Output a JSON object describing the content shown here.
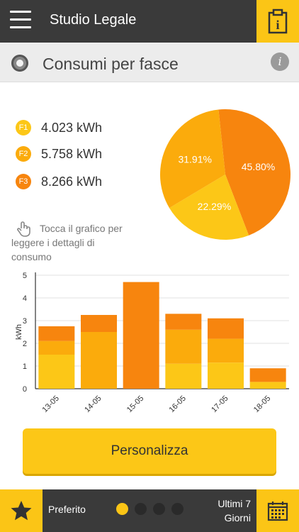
{
  "header": {
    "title": "Studio Legale",
    "menu_icon": "hamburger-icon",
    "info_icon": "clipboard-info-icon",
    "info_glyph": "i"
  },
  "section": {
    "title": "Consumi per fasce",
    "info_glyph": "i"
  },
  "legend": [
    {
      "badge": "F1",
      "value": "4.023 kWh",
      "color": "#fcc717"
    },
    {
      "badge": "F2",
      "value": "5.758 kWh",
      "color": "#fbab0c"
    },
    {
      "badge": "F3",
      "value": "8.266 kWh",
      "color": "#f7850e"
    }
  ],
  "hint": {
    "line1": "Tocca il grafico per",
    "line2": "leggere i dettagli di",
    "line3": "consumo"
  },
  "colors": {
    "f1": "#fcc717",
    "f2": "#fbab0c",
    "f3": "#f7850e",
    "accent": "#fbc516",
    "bar_dark": "#3a3a3a"
  },
  "chart_data": [
    {
      "type": "pie",
      "labels": [
        "F3",
        "F1",
        "F2"
      ],
      "values": [
        45.8,
        22.29,
        31.91
      ],
      "data_labels": [
        "45.80%",
        "22.29%",
        "31.91%"
      ],
      "colors": [
        "#f7850e",
        "#fcc717",
        "#fbab0c"
      ]
    },
    {
      "type": "bar",
      "stacked": true,
      "categories": [
        "13-05",
        "14-05",
        "15-05",
        "16-05",
        "17-05",
        "18-05"
      ],
      "series": [
        {
          "values": [
            1.5,
            0.0,
            0.0,
            1.1,
            1.15,
            0.3
          ],
          "color": "#fcc717"
        },
        {
          "values": [
            0.6,
            2.5,
            0.0,
            1.5,
            1.05,
            0.0
          ],
          "color": "#fbab0c"
        },
        {
          "values": [
            0.65,
            0.75,
            4.7,
            0.7,
            0.9,
            0.6
          ],
          "color": "#f7850e"
        }
      ],
      "ylabel": "kWh",
      "ylim": [
        0,
        5
      ],
      "yticks": [
        "0",
        "1",
        "2",
        "3",
        "4",
        "5"
      ],
      "grid": true
    }
  ],
  "button": {
    "label": "Personalizza"
  },
  "footer": {
    "favorite_label": "Preferito",
    "period_line1": "Ultimi 7",
    "period_line2": "Giorni",
    "star_icon": "star-icon",
    "calendar_icon": "calendar-icon",
    "page_count": 4,
    "active_page": 1
  }
}
